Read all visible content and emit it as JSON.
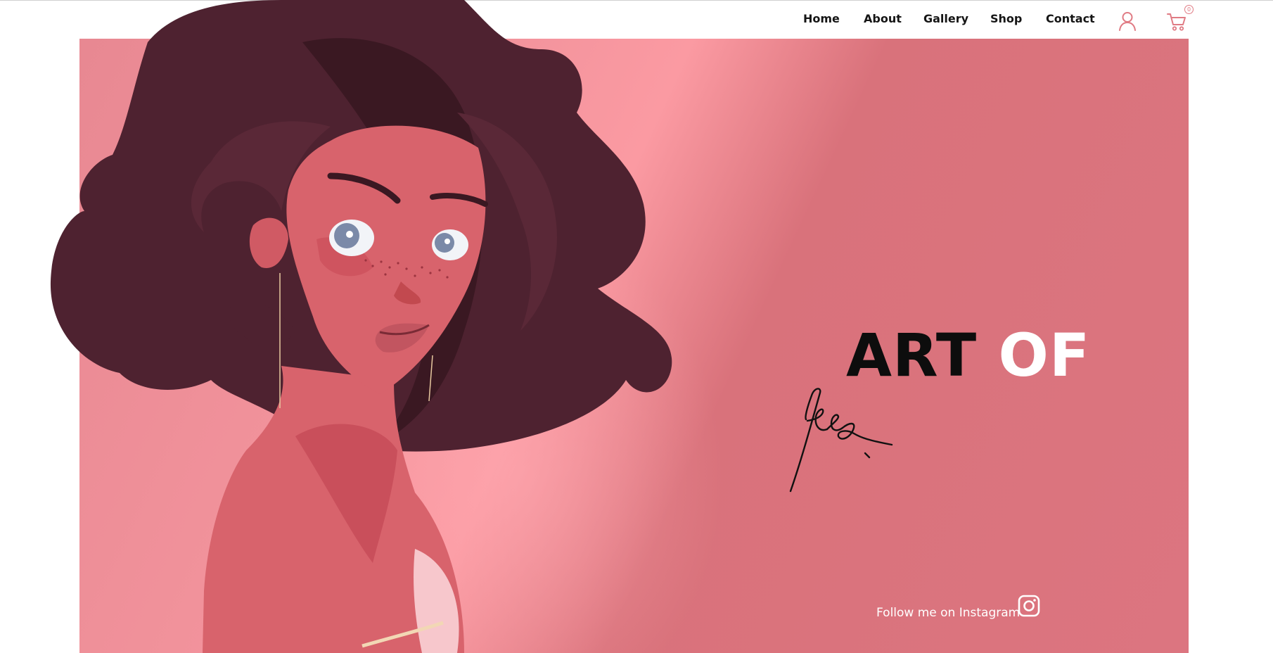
{
  "nav": {
    "items": [
      {
        "label": "Home"
      },
      {
        "label": "About"
      },
      {
        "label": "Gallery"
      },
      {
        "label": "Shop"
      },
      {
        "label": "Contact"
      }
    ],
    "account_icon": "user-icon",
    "cart_icon": "cart-icon",
    "cart_count": "0"
  },
  "hero": {
    "headline_dark": "ART",
    "headline_light": "OF",
    "signature_text": "Tess.",
    "instagram_text": "Follow me on Instagram",
    "instagram_icon": "instagram-icon"
  },
  "colors": {
    "accent": "#e07b84",
    "hero_background": "#dc7580",
    "hair": "#4e2230",
    "skin": "#d8636c"
  }
}
